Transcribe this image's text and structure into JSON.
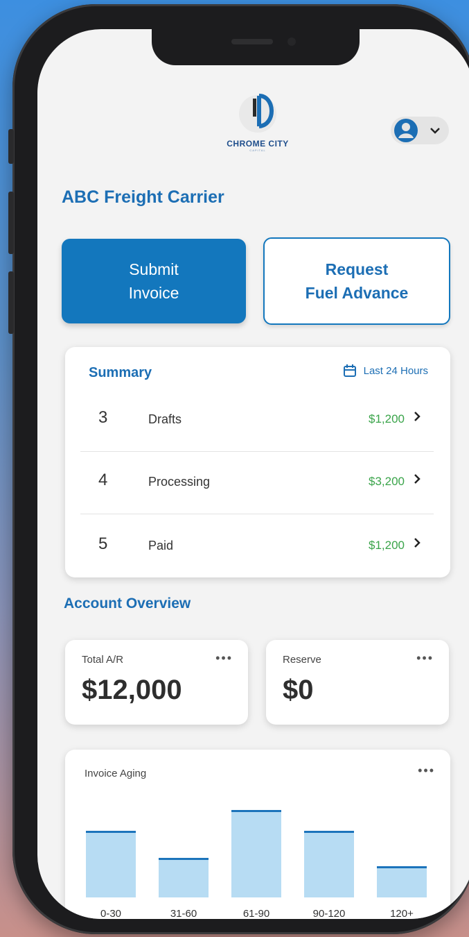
{
  "brand": {
    "name": "CHROME CITY",
    "sub": "CAPITAL"
  },
  "company": "ABC Freight Carrier",
  "actions": {
    "submit_label": "Submit\nInvoice",
    "fuel_label": "Request\nFuel Advance"
  },
  "summary": {
    "title": "Summary",
    "period": "Last 24 Hours",
    "rows": [
      {
        "count": "3",
        "label": "Drafts",
        "amount": "$1,200"
      },
      {
        "count": "4",
        "label": "Processing",
        "amount": "$3,200"
      },
      {
        "count": "5",
        "label": "Paid",
        "amount": "$1,200"
      }
    ]
  },
  "overview": {
    "title": "Account Overview",
    "total_ar": {
      "label": "Total A/R",
      "value": "$12,000"
    },
    "reserve": {
      "label": "Reserve",
      "value": "$0"
    },
    "more": "•••"
  },
  "aging": {
    "title": "Invoice Aging",
    "chart_data": {
      "type": "bar",
      "categories": [
        "0-30",
        "31-60",
        "61-90",
        "90-120",
        "120+"
      ],
      "values": [
        62,
        36,
        82,
        62,
        28
      ],
      "ylim": [
        0,
        100
      ],
      "grid": false
    }
  },
  "colors": {
    "primary": "#1377bd",
    "accent_text": "#1c6eb4",
    "amount": "#3aa44a",
    "bar": "#b7dcf3"
  },
  "icons": {
    "avatar": "user-avatar-icon",
    "chevron": "chevron-down-icon",
    "calendar": "calendar-icon",
    "arrow": "chevron-right-icon"
  }
}
